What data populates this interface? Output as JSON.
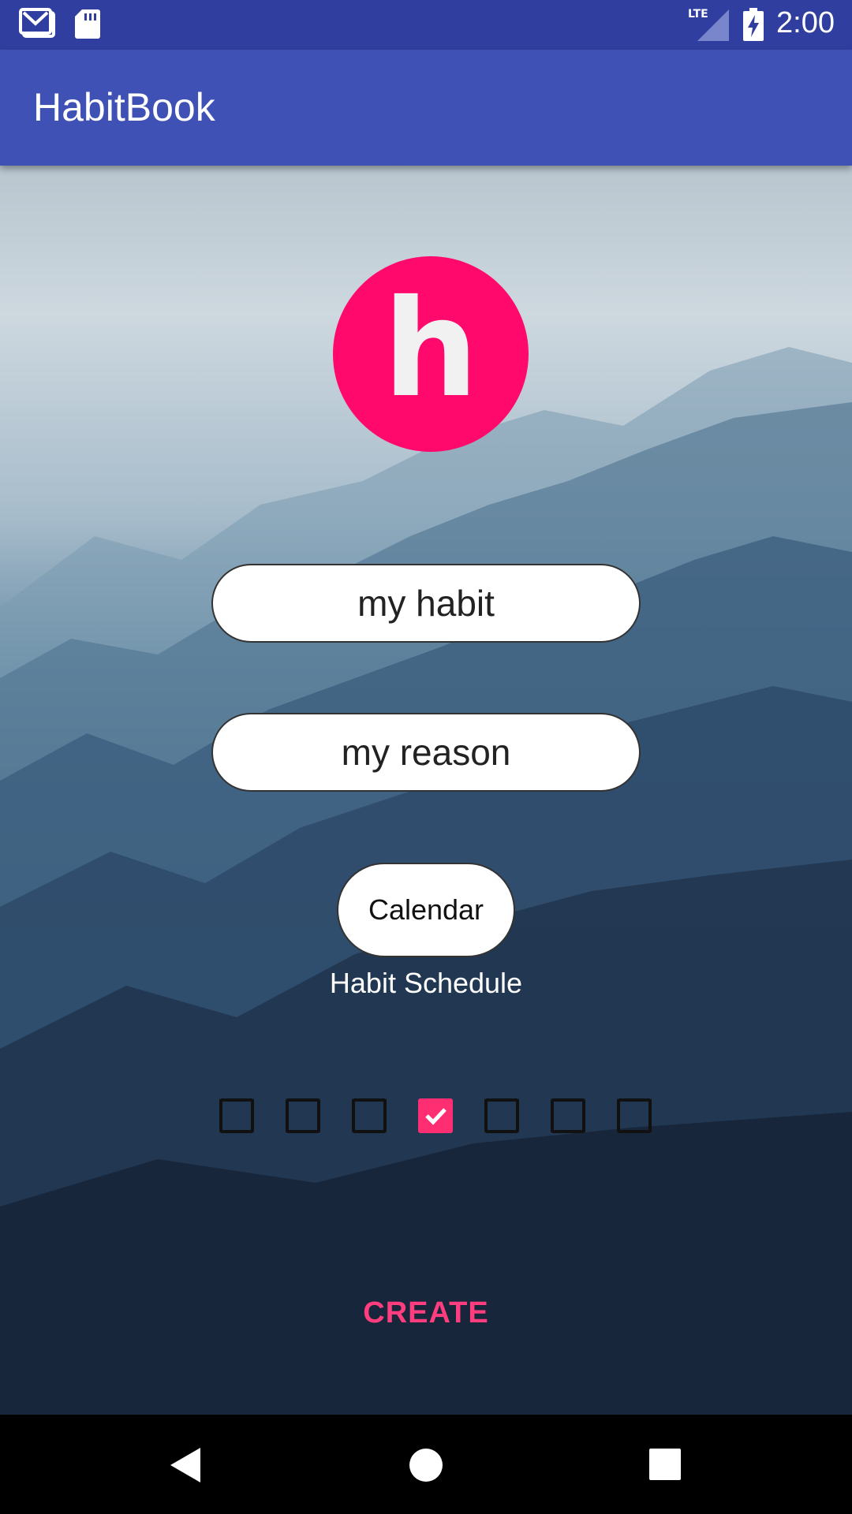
{
  "status_bar": {
    "time": "2:00",
    "network": "LTE",
    "icons": [
      "gmail-icon",
      "sd-card-icon",
      "lte-signal-icon",
      "battery-charging-icon"
    ]
  },
  "app_bar": {
    "title": "HabitBook"
  },
  "logo": {
    "letter": "h",
    "color": "#ff0a6c"
  },
  "form": {
    "habit_value": "my habit",
    "reason_value": "my reason",
    "calendar_label": "Calendar",
    "schedule_label": "Habit Schedule",
    "schedule_days": [
      {
        "checked": false
      },
      {
        "checked": false
      },
      {
        "checked": false
      },
      {
        "checked": true
      },
      {
        "checked": false
      },
      {
        "checked": false
      },
      {
        "checked": false
      }
    ],
    "create_label": "CREATE"
  },
  "colors": {
    "primary": "#3f51b5",
    "primary_dark": "#303f9f",
    "accent": "#ff2e72"
  },
  "nav_bar": {
    "icons": [
      "back-icon",
      "home-icon",
      "recents-icon"
    ]
  }
}
